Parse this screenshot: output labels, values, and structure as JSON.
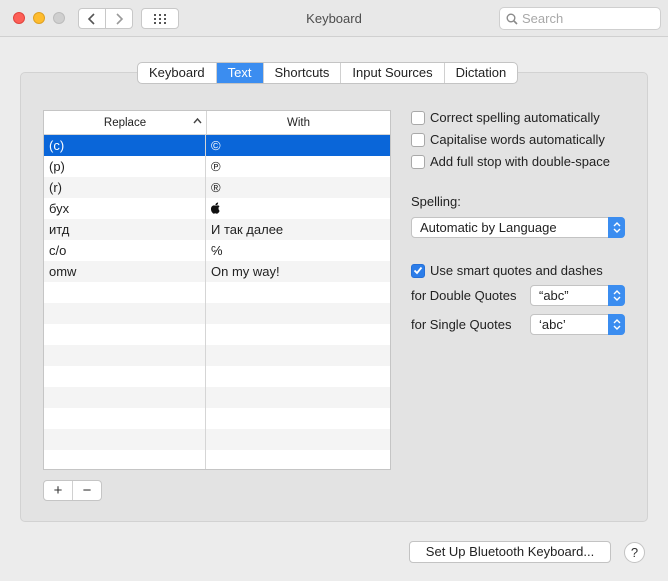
{
  "window": {
    "title": "Keyboard"
  },
  "search": {
    "placeholder": "Search"
  },
  "tabs": [
    {
      "label": "Keyboard"
    },
    {
      "label": "Text",
      "active": true
    },
    {
      "label": "Shortcuts"
    },
    {
      "label": "Input Sources"
    },
    {
      "label": "Dictation"
    }
  ],
  "table": {
    "headers": {
      "replace": "Replace",
      "with": "With"
    },
    "rows": [
      {
        "replace": "(c)",
        "with": "©"
      },
      {
        "replace": "(p)",
        "with": "℗"
      },
      {
        "replace": "(r)",
        "with": "®"
      },
      {
        "replace": "бух",
        "with": ""
      },
      {
        "replace": "итд",
        "with": "И так далее"
      },
      {
        "replace": "c/o",
        "with": "℅"
      },
      {
        "replace": "omw",
        "with": "On my way!"
      }
    ]
  },
  "buttons": {
    "add": "+",
    "remove": "−",
    "bluetooth": "Set Up Bluetooth Keyboard...",
    "help": "?"
  },
  "options": {
    "correct_spelling": {
      "label": "Correct spelling automatically",
      "checked": false
    },
    "capitalise": {
      "label": "Capitalise words automatically",
      "checked": false
    },
    "full_stop": {
      "label": "Add full stop with double-space",
      "checked": false
    },
    "spelling_label": "Spelling:",
    "spelling_value": "Automatic by Language",
    "smart_quotes": {
      "label": "Use smart quotes and dashes",
      "checked": true
    },
    "double_quotes_label": "for Double Quotes",
    "double_quotes_value": "“abc”",
    "single_quotes_label": "for Single Quotes",
    "single_quotes_value": "‘abc’"
  },
  "icons": {
    "apple_logo": "apple-logo-icon",
    "search": "search-icon",
    "back": "chevron-left-icon",
    "forward": "chevron-right-icon",
    "grid": "grid-icon"
  },
  "colors": {
    "accent": "#3b8df0",
    "selection": "#0a66d9"
  }
}
